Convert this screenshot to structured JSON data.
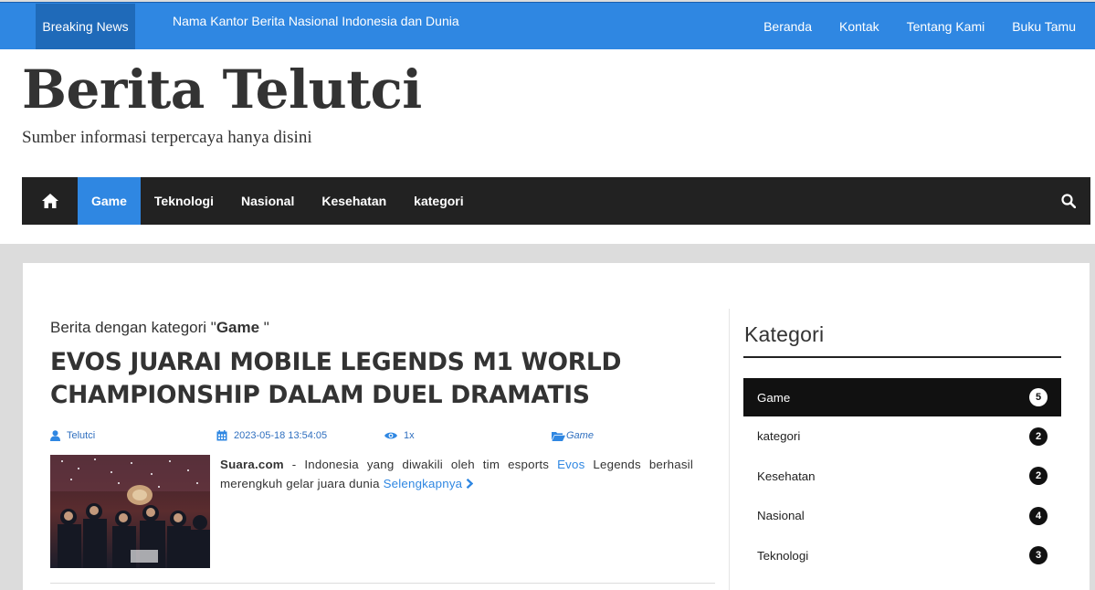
{
  "topbar": {
    "breaking_label": "Breaking News",
    "ticker_text": "Nama Kantor Berita Nasional Indonesia dan Dunia",
    "links": [
      "Beranda",
      "Kontak",
      "Tentang Kami",
      "Buku Tamu"
    ]
  },
  "header": {
    "site_title": "Berita Telutci",
    "tagline": "Sumber informasi terpercaya hanya disini"
  },
  "nav": {
    "items": [
      "Game",
      "Teknologi",
      "Nasional",
      "Kesehatan",
      "kategori"
    ],
    "active": "Game"
  },
  "main": {
    "category_prefix": "Berita dengan kategori \"",
    "category_name": "Game",
    "category_suffix": " \"",
    "post": {
      "title": "EVOS JUARAI MOBILE LEGENDS M1 WORLD CHAMPIONSHIP DALAM DUEL DRAMATIS",
      "author": "Telutci",
      "datetime": "2023-05-18 13:54:05",
      "views": "1x",
      "category": "Game",
      "excerpt_source": "Suara.com",
      "excerpt_part1": " - Indonesia yang diwakili oleh tim esports ",
      "excerpt_highlight": "Evos",
      "excerpt_part2": " Legends berhasil merengkuh gelar juara dunia ",
      "read_more": "Selengkapnya"
    }
  },
  "sidebar": {
    "title": "Kategori",
    "items": [
      {
        "label": "Game",
        "count": "5"
      },
      {
        "label": "kategori",
        "count": "2"
      },
      {
        "label": "Kesehatan",
        "count": "2"
      },
      {
        "label": "Nasional",
        "count": "4"
      },
      {
        "label": "Teknologi",
        "count": "3"
      }
    ]
  },
  "colors": {
    "accent": "#2f87e2",
    "nav_bg": "#222222",
    "page_bg": "#dcdcdc"
  }
}
